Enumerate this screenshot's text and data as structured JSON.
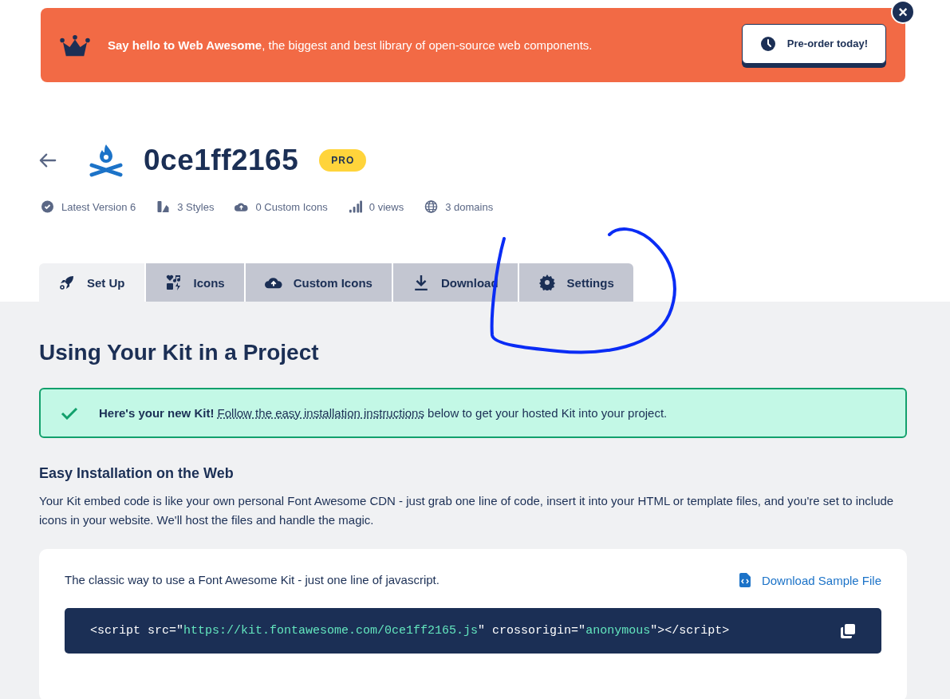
{
  "banner": {
    "message": "**Say hello to Web Awesome**, the biggest and best library of open-source web components.",
    "button": "Pre-order today!",
    "close": "×"
  },
  "kit": {
    "title": "0ce1ff2165",
    "badge": "PRO",
    "stats": [
      "Latest Version 6",
      "3 Styles",
      "0 Custom Icons",
      "0 views",
      "3 domains"
    ]
  },
  "tabs": [
    {
      "label": "Set Up",
      "selected": true
    },
    {
      "label": "Icons",
      "selected": false
    },
    {
      "label": "Custom Icons",
      "selected": false
    },
    {
      "label": "Download",
      "selected": false
    },
    {
      "label": "Settings",
      "selected": false
    }
  ],
  "heading": "Using Your Kit in a Project",
  "notice": {
    "lead": "Here's your new Kit!",
    "link": "Follow the easy installation instructions",
    "rest": " below to get your hosted Kit into your project."
  },
  "section": {
    "title": "Easy Installation on the Web",
    "body": "Your Kit embed code is like your own personal Font Awesome CDN - just grab one line of code, insert it into your HTML or template files, and you're set to include icons in your website. We'll host the files and handle the magic."
  },
  "card": {
    "description": "The classic way to use a Font Awesome Kit - just one line of javascript.",
    "link": "Download Sample File",
    "code": [
      {
        "kind": "plain",
        "text": "<script src=\""
      },
      {
        "kind": "string",
        "text": "https://kit.fontawesome.com/0ce1ff2165.js"
      },
      {
        "kind": "plain",
        "text": "\" crossorigin=\""
      },
      {
        "kind": "string",
        "text": "anonymous"
      },
      {
        "kind": "plain",
        "text": "\"></script>"
      }
    ]
  }
}
